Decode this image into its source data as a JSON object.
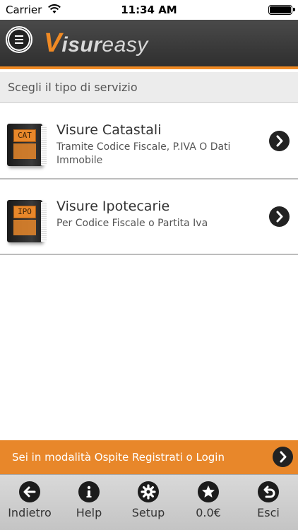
{
  "status_bar": {
    "carrier": "Carrier",
    "time": "11:34 AM"
  },
  "header": {
    "logo_v": "V",
    "logo_isur": "isur",
    "logo_easy": "easy"
  },
  "section": {
    "title": "Scegli il tipo di servizio"
  },
  "services": [
    {
      "badge": "CAT",
      "title": "Visure Catastali",
      "subtitle": "Tramite Codice Fiscale, P.IVA O Dati Immobile"
    },
    {
      "badge": "IPO",
      "title": "Visure Ipotecarie",
      "subtitle": "Per Codice Fiscale o Partita Iva"
    }
  ],
  "guest_bar": {
    "text": "Sei in modalità Ospite Registrati o Login"
  },
  "tabs": [
    {
      "label": "Indietro",
      "icon": "back-arrow-icon"
    },
    {
      "label": "Help",
      "icon": "info-icon"
    },
    {
      "label": "Setup",
      "icon": "gear-icon"
    },
    {
      "label": "0.0€",
      "icon": "star-icon"
    },
    {
      "label": "Esci",
      "icon": "undo-icon"
    }
  ],
  "colors": {
    "accent": "#e8872a",
    "header": "#3a3a3a",
    "icon": "#1c1c1c"
  }
}
